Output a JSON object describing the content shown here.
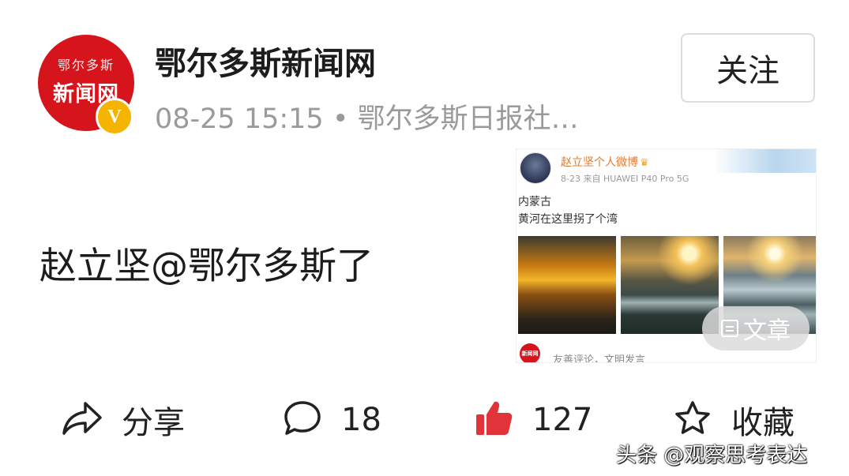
{
  "account": {
    "avatar_top_text": "鄂尔多斯",
    "avatar_main_text": "新闻网",
    "verified_badge": "V",
    "name": "鄂尔多斯新闻网",
    "meta": "08-25 15:15 • 鄂尔多斯日报社…"
  },
  "follow_button": {
    "label": "关注"
  },
  "post": {
    "text": "赵立坚@鄂尔多斯了"
  },
  "thumbnail": {
    "author": "赵立坚个人微博",
    "meta": "8-23  来自 HUAWEI P40 Pro 5G",
    "line1": "内蒙古",
    "line2": "黄河在这里拐了个湾",
    "logo_text": "新闻网",
    "comment_placeholder": "友善评论，文明发言",
    "badge_label": "文章"
  },
  "actions": {
    "share_label": "分享",
    "comment_count": "18",
    "like_count": "127",
    "favorite_label": "收藏"
  },
  "watermark": "头条 @观察思考表达",
  "colors": {
    "brand_red": "#d6141b",
    "verified_yellow": "#f4b400",
    "like_red": "#e0343a",
    "meta_gray": "#9a9a9a"
  },
  "icons": [
    "share-icon",
    "comment-icon",
    "thumbs-up-icon",
    "star-icon",
    "document-icon",
    "verified-icon"
  ]
}
